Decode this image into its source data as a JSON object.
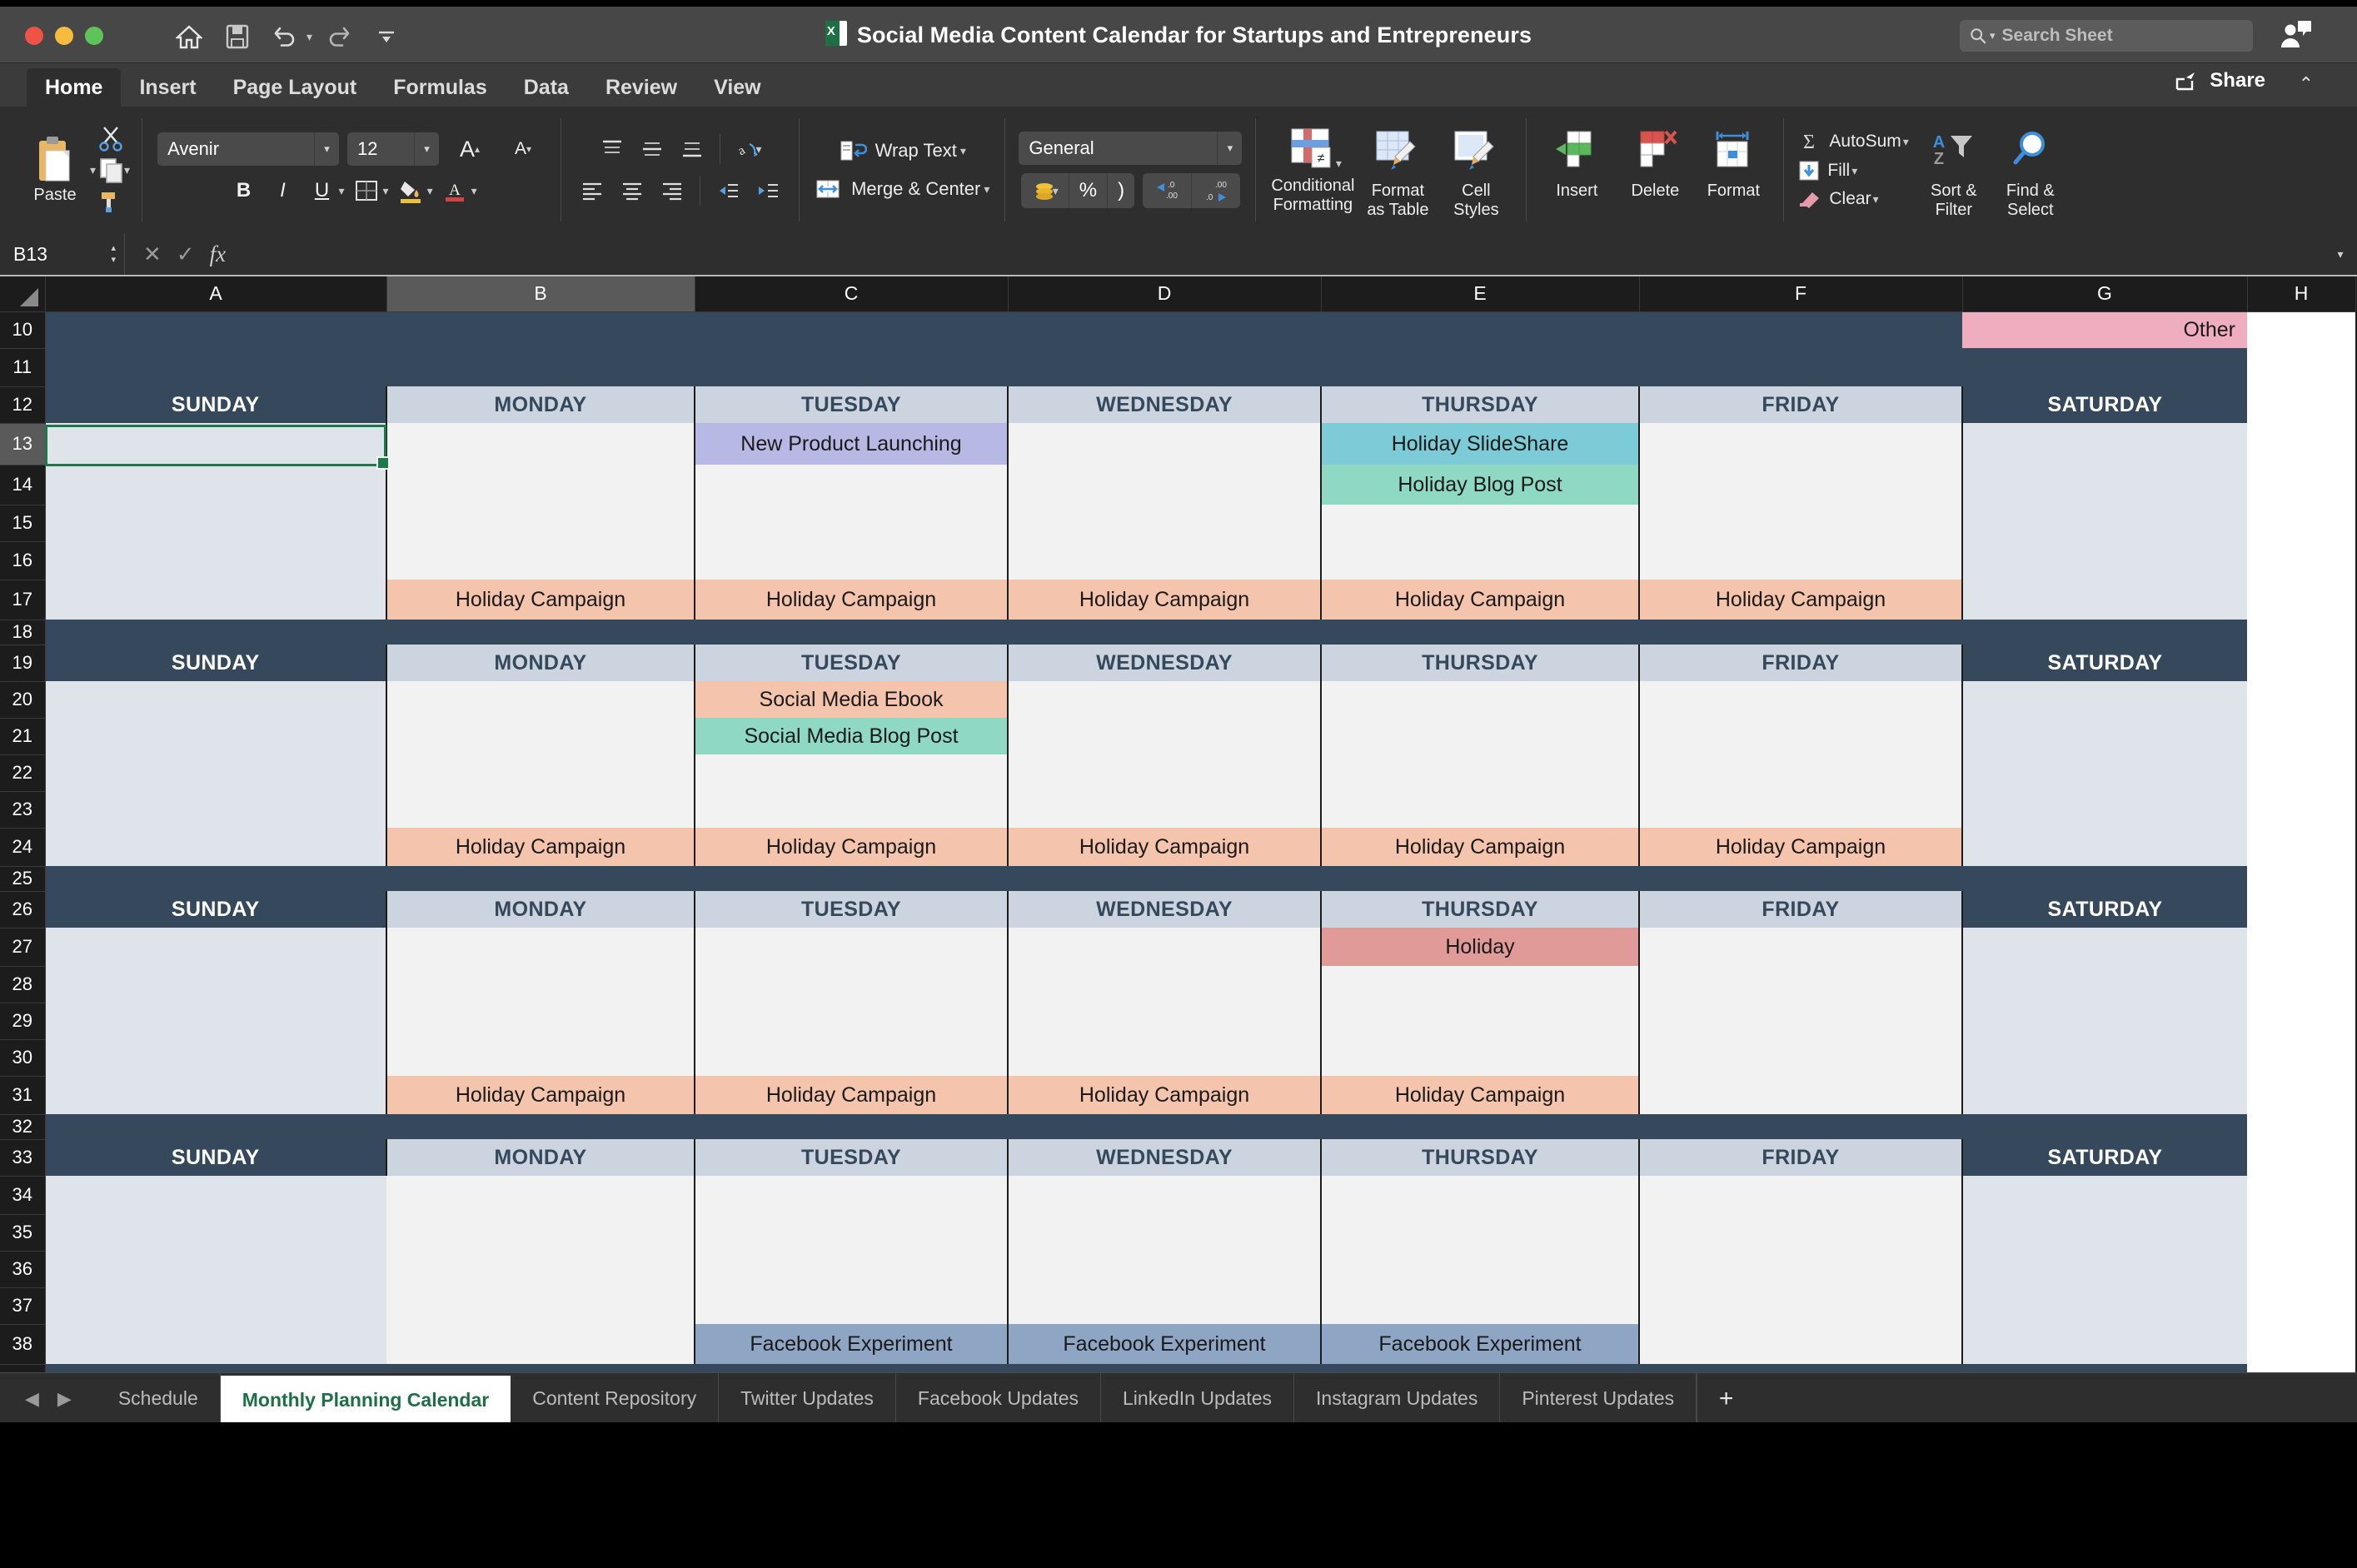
{
  "window": {
    "title": "Social Media Content Calendar for Startups and Entrepreneurs",
    "app_icon": "excel-icon"
  },
  "search": {
    "placeholder": "Search Sheet"
  },
  "share": {
    "label": "Share"
  },
  "ribbon_tabs": [
    {
      "label": "Home",
      "active": true
    },
    {
      "label": "Insert",
      "active": false
    },
    {
      "label": "Page Layout",
      "active": false
    },
    {
      "label": "Formulas",
      "active": false
    },
    {
      "label": "Data",
      "active": false
    },
    {
      "label": "Review",
      "active": false
    },
    {
      "label": "View",
      "active": false
    }
  ],
  "ribbon": {
    "clipboard": {
      "paste_label": "Paste",
      "cut_icon": "scissors-icon",
      "copy_icon": "copy-icon",
      "format_painter_icon": "paintbrush-icon"
    },
    "font": {
      "family": "Avenir",
      "size": "12",
      "grow_label": "A",
      "shrink_label": "A",
      "bold": "B",
      "italic": "I",
      "underline": "U",
      "borders_icon": "borders-icon",
      "fill_icon": "fill-color-icon",
      "font_color_icon": "font-color-icon"
    },
    "alignment": {
      "wrap_text": "Wrap Text",
      "merge_center": "Merge & Center",
      "align_left_icon": "align-left-icon",
      "align_center_icon": "align-center-icon",
      "align_right_icon": "align-right-icon",
      "orientation_icon": "text-orientation-icon",
      "indent_decrease_icon": "decrease-indent-icon",
      "indent_increase_icon": "increase-indent-icon"
    },
    "number": {
      "format": "General",
      "currency_icon": "currency-icon",
      "percent": "%",
      "comma": ")",
      "decrease_decimal": ".00",
      "increase_decimal": ".0"
    },
    "styles": [
      {
        "label": "Conditional\nFormatting",
        "line1": "Conditional",
        "line2": "Formatting",
        "icon": "conditional-formatting-icon"
      },
      {
        "label": "Format as Table",
        "line1": "Format",
        "line2": "as Table",
        "icon": "format-as-table-icon"
      },
      {
        "label": "Cell Styles",
        "line1": "Cell",
        "line2": "Styles",
        "icon": "cell-styles-icon"
      }
    ],
    "cells": [
      {
        "line1": "Insert",
        "line2": "",
        "icon": "insert-cells-icon"
      },
      {
        "line1": "Delete",
        "line2": "",
        "icon": "delete-cells-icon"
      },
      {
        "line1": "Format",
        "line2": "",
        "icon": "format-cells-icon"
      }
    ],
    "editing": {
      "autosum": "AutoSum",
      "fill": "Fill",
      "clear": "Clear",
      "sort_filter_l1": "Sort &",
      "sort_filter_l2": "Filter",
      "find_select_l1": "Find &",
      "find_select_l2": "Select"
    }
  },
  "formula_bar": {
    "name_box": "B13",
    "formula": "",
    "cancel_icon": "cancel-icon",
    "accept_icon": "accept-icon",
    "function_icon": "fx-icon"
  },
  "grid": {
    "columns": [
      "A",
      "B",
      "C",
      "D",
      "E",
      "F",
      "G",
      "H"
    ],
    "selected_column": "B",
    "selected_row": 13,
    "rows": [
      10,
      11,
      12,
      13,
      14,
      15,
      16,
      17,
      18,
      19,
      20,
      21,
      22,
      23,
      24,
      25,
      26,
      27,
      28,
      29,
      30,
      31,
      32,
      33,
      34,
      35,
      36,
      37,
      38
    ],
    "weekday_headers": [
      "SUNDAY",
      "MONDAY",
      "TUESDAY",
      "WEDNESDAY",
      "THURSDAY",
      "FRIDAY",
      "SATURDAY"
    ],
    "legend_other": "Other",
    "events": {
      "new_product_launching": "New Product Launching",
      "holiday_slideshare": "Holiday SlideShare",
      "holiday_blog_post": "Holiday Blog Post",
      "holiday_campaign": "Holiday Campaign",
      "social_media_ebook": "Social Media Ebook",
      "social_media_blog_post": "Social Media Blog Post",
      "holiday": "Holiday",
      "facebook_experiment": "Facebook Experiment"
    },
    "colors": {
      "header_dark": "#36495c",
      "header_light": "#ccd4e0",
      "body": "#f2f2f2",
      "body_alt": "#dfe3ea",
      "peach": "#f5c4ac",
      "salmon": "#efa89a",
      "rose": "#e09a98",
      "mint": "#8fd9c4",
      "teal": "#7ccbd6",
      "lavender": "#b7b9e4",
      "steel": "#8fa5c4",
      "pink": "#efaec0",
      "selection": "#1c7a4a"
    }
  },
  "sheet_tabs": [
    {
      "label": "Schedule",
      "active": false
    },
    {
      "label": "Monthly Planning Calendar",
      "active": true
    },
    {
      "label": "Content Repository",
      "active": false
    },
    {
      "label": "Twitter Updates",
      "active": false
    },
    {
      "label": "Facebook Updates",
      "active": false
    },
    {
      "label": "LinkedIn Updates",
      "active": false
    },
    {
      "label": "Instagram Updates",
      "active": false
    },
    {
      "label": "Pinterest Updates",
      "active": false
    }
  ],
  "add_sheet": "+"
}
